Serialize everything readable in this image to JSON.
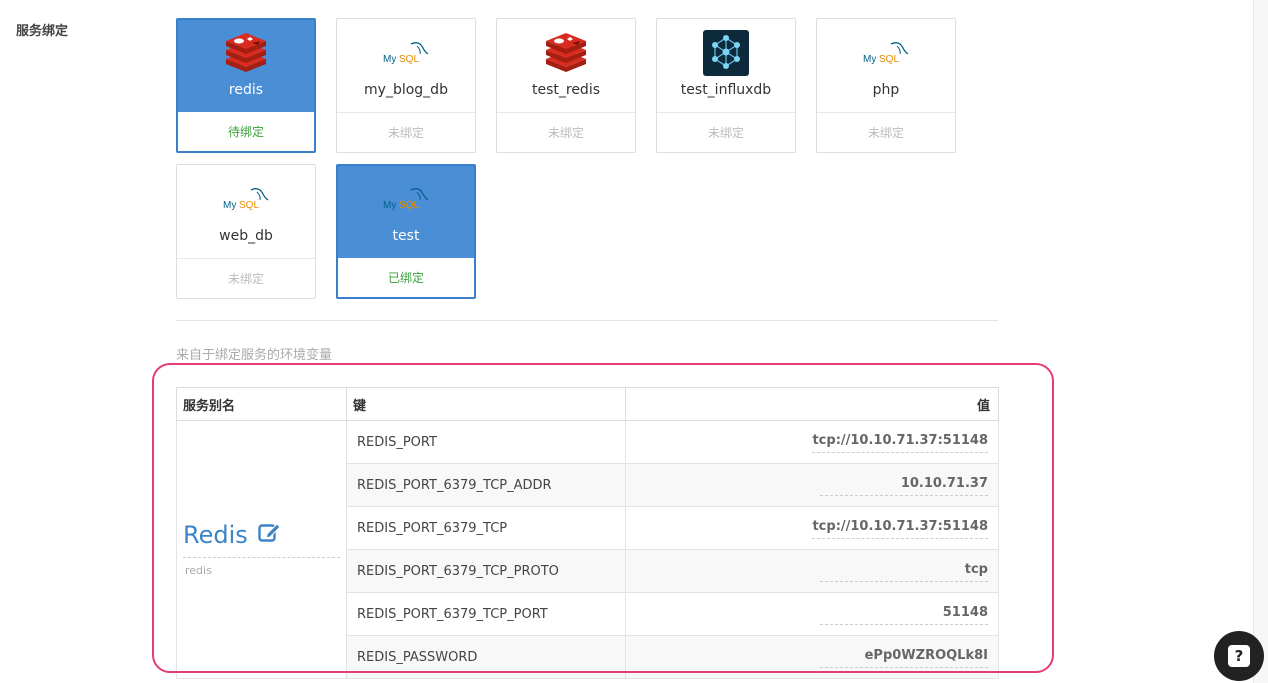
{
  "section_label": "服务绑定",
  "cards": [
    {
      "name": "redis",
      "logo": "redis-logo",
      "status": "待绑定",
      "selected": true
    },
    {
      "name": "my_blog_db",
      "logo": "mysql-logo",
      "status": "未绑定",
      "selected": false
    },
    {
      "name": "test_redis",
      "logo": "redis-logo",
      "status": "未绑定",
      "selected": false
    },
    {
      "name": "test_influxdb",
      "logo": "influxdb-logo",
      "status": "未绑定",
      "selected": false
    },
    {
      "name": "php",
      "logo": "mysql-logo",
      "status": "未绑定",
      "selected": false
    },
    {
      "name": "web_db",
      "logo": "mysql-logo",
      "status": "未绑定",
      "selected": false
    },
    {
      "name": "test",
      "logo": "mysql-logo",
      "status": "已绑定",
      "selected": true
    }
  ],
  "env_caption": "来自于绑定服务的环境变量",
  "table": {
    "headers": {
      "alias": "服务别名",
      "key": "键",
      "value": "值"
    },
    "alias_title": "Redis",
    "alias_sub": "redis",
    "rows": [
      {
        "key": "REDIS_PORT",
        "value": "tcp://10.10.71.37:51148"
      },
      {
        "key": "REDIS_PORT_6379_TCP_ADDR",
        "value": "10.10.71.37"
      },
      {
        "key": "REDIS_PORT_6379_TCP",
        "value": "tcp://10.10.71.37:51148"
      },
      {
        "key": "REDIS_PORT_6379_TCP_PROTO",
        "value": "tcp"
      },
      {
        "key": "REDIS_PORT_6379_TCP_PORT",
        "value": "51148"
      },
      {
        "key": "REDIS_PASSWORD",
        "value": "ePp0WZROQLk8I"
      }
    ]
  },
  "help_label": "?",
  "colors": {
    "selected": "#4a8fd6",
    "bound": "#3aa33a",
    "highlight": "#e43c73"
  }
}
